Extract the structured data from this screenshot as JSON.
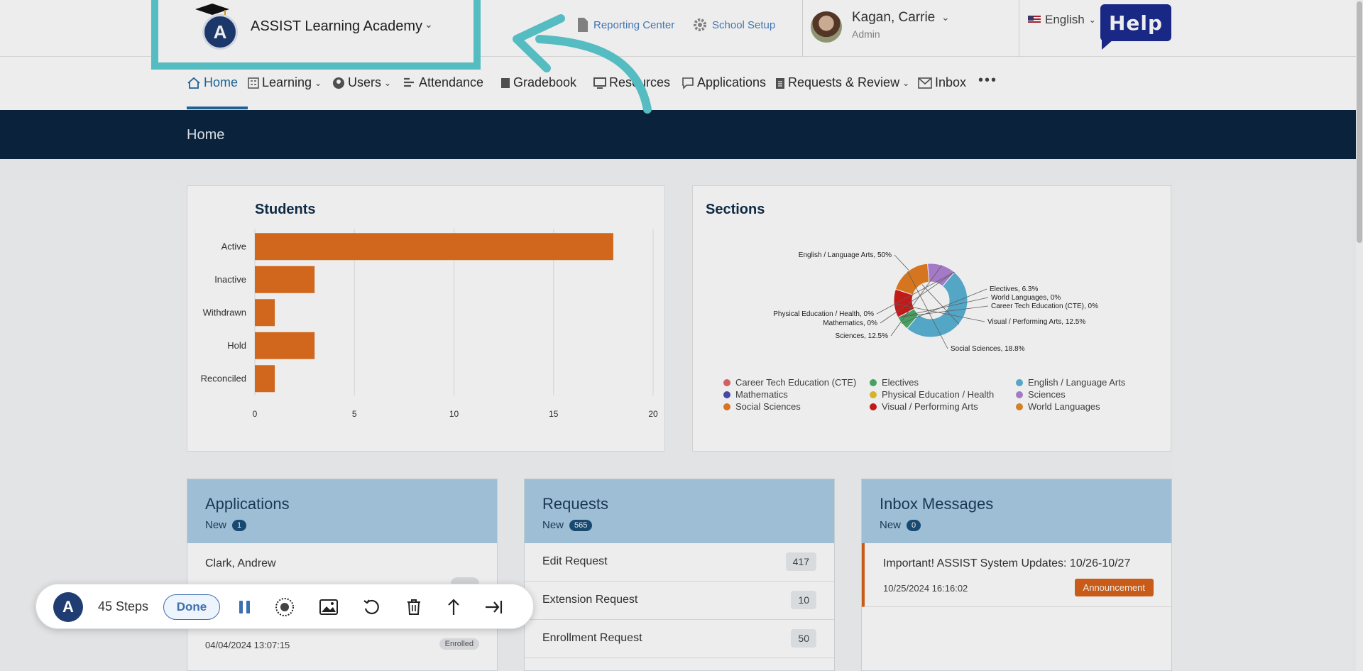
{
  "header": {
    "org_name": "ASSIST Learning Academy",
    "logo_letter": "A",
    "reporting_center": "Reporting Center",
    "school_setup": "School Setup",
    "user_name": "Kagan, Carrie",
    "user_role": "Admin",
    "language": "English",
    "help": "Help"
  },
  "nav": {
    "items": [
      {
        "label": "Home"
      },
      {
        "label": "Learning"
      },
      {
        "label": "Users"
      },
      {
        "label": "Attendance"
      },
      {
        "label": "Gradebook"
      },
      {
        "label": "Resources"
      },
      {
        "label": "Applications"
      },
      {
        "label": "Requests & Review"
      },
      {
        "label": "Inbox"
      },
      {
        "label": "•••"
      }
    ]
  },
  "page_title": "Home",
  "students": {
    "title": "Students",
    "chart_data": {
      "type": "bar",
      "orientation": "horizontal",
      "categories": [
        "Active",
        "Inactive",
        "Withdrawn",
        "Hold",
        "Reconciled"
      ],
      "values": [
        18,
        3,
        1,
        3,
        1
      ],
      "xlim": [
        0,
        20
      ],
      "xticks": [
        0,
        5,
        10,
        15,
        20
      ],
      "color": "#e06f1f"
    }
  },
  "sections": {
    "title": "Sections",
    "chart_data": {
      "type": "pie",
      "slices": [
        {
          "name": "English / Language Arts",
          "value": 50,
          "label": "English / Language Arts, 50%",
          "color": "#5bb3d6"
        },
        {
          "name": "Electives",
          "value": 6.3,
          "label": "Electives, 6.3%",
          "color": "#4caf6a"
        },
        {
          "name": "World Languages",
          "value": 0,
          "label": "World Languages, 0%",
          "color": "#e38a2b"
        },
        {
          "name": "Career Tech Education (CTE)",
          "value": 0,
          "label": "Career Tech Education (CTE), 0%",
          "color": "#e0686e"
        },
        {
          "name": "Visual / Performing Arts",
          "value": 12.5,
          "label": "Visual / Performing Arts, 12.5%",
          "color": "#d11b1b"
        },
        {
          "name": "Social Sciences",
          "value": 18.8,
          "label": "Social Sciences, 18.8%",
          "color": "#e67e22"
        },
        {
          "name": "Sciences",
          "value": 12.5,
          "label": "Sciences, 12.5%",
          "color": "#b184d6"
        },
        {
          "name": "Mathematics",
          "value": 0,
          "label": "Mathematics, 0%",
          "color": "#4b4fb0"
        },
        {
          "name": "Physical Education / Health",
          "value": 0,
          "label": "Physical Education / Health, 0%",
          "color": "#e6c22e"
        }
      ],
      "legend": [
        {
          "name": "Career Tech Education (CTE)",
          "color": "#e0686e"
        },
        {
          "name": "Electives",
          "color": "#4caf6a"
        },
        {
          "name": "English / Language Arts",
          "color": "#5bb3d6"
        },
        {
          "name": "Mathematics",
          "color": "#4b4fb0"
        },
        {
          "name": "Physical Education / Health",
          "color": "#e6c22e"
        },
        {
          "name": "Sciences",
          "color": "#b184d6"
        },
        {
          "name": "Social Sciences",
          "color": "#e67e22"
        },
        {
          "name": "Visual / Performing Arts",
          "color": "#d11b1b"
        },
        {
          "name": "World Languages",
          "color": "#e38a2b"
        }
      ]
    }
  },
  "applications": {
    "title": "Applications",
    "new_label": "New",
    "new_count": "1",
    "first_name": "Clark, Andrew",
    "last_date": "04/04/2024 13:07:15",
    "last_status": "Enrolled"
  },
  "requests": {
    "title": "Requests",
    "new_label": "New",
    "new_count": "565",
    "rows": [
      {
        "label": "Edit Request",
        "count": "417"
      },
      {
        "label": "Extension Request",
        "count": "10"
      },
      {
        "label": "Enrollment Request",
        "count": "50"
      }
    ]
  },
  "inbox": {
    "title": "Inbox Messages",
    "new_label": "New",
    "new_count": "0",
    "message_title": "Important! ASSIST System Updates: 10/26-10/27",
    "message_date": "10/25/2024 16:16:02",
    "message_tag": "Announcement"
  },
  "recorder": {
    "steps": "45 Steps",
    "done": "Done"
  }
}
